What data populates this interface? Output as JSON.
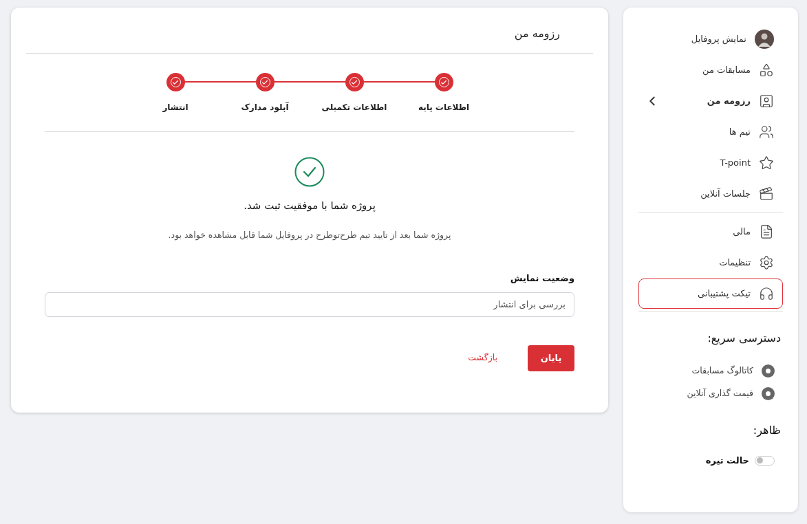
{
  "main": {
    "title": "رزومه من",
    "steps": [
      {
        "label": "اطلاعات پایه",
        "done": true
      },
      {
        "label": "اطلاعات تکمیلی",
        "done": true
      },
      {
        "label": "آپلود مدارک",
        "done": true
      },
      {
        "label": "انتشار",
        "done": true
      }
    ],
    "success_title": "پروژه شما با موفقیت ثبت شد.",
    "success_text": "پروژه شما بعد از تایید تیم طرح‌توطرح در پروفایل شما قابل مشاهده خواهد بود.",
    "field": {
      "label": "وضعیت نمایش",
      "value": "بررسی برای انتشار"
    },
    "buttons": {
      "primary": "پایان",
      "secondary": "بازگشت"
    }
  },
  "sidebar": {
    "sections": [
      [
        {
          "label": "نمایش پروفایل",
          "kind": "avatar",
          "selected": false,
          "outlined": false
        },
        {
          "label": "مسابقات من",
          "kind": "icon",
          "selected": false,
          "outlined": false
        },
        {
          "label": "رزومه من",
          "kind": "icon",
          "selected": true,
          "outlined": false
        },
        {
          "label": "تیم ها",
          "kind": "icon",
          "selected": false,
          "outlined": false
        },
        {
          "label": "T-point",
          "kind": "icon",
          "selected": false,
          "outlined": false
        },
        {
          "label": "جلسات آنلاین",
          "kind": "icon",
          "selected": false,
          "outlined": false
        }
      ],
      [
        {
          "label": "مالی",
          "kind": "icon",
          "selected": false,
          "outlined": false
        },
        {
          "label": "تنظیمات",
          "kind": "icon",
          "selected": false,
          "outlined": false
        },
        {
          "label": "تیکت پشتیبانی",
          "kind": "icon",
          "selected": false,
          "outlined": true
        }
      ]
    ],
    "quick_access": {
      "title": "دسترسی سریع:",
      "items": [
        "کاتالوگ مسابقات",
        "قیمت گذاری آنلاین"
      ]
    },
    "appearance": {
      "title": "ظاهر:",
      "toggle": {
        "label": "حالت تیره",
        "on": false
      }
    }
  }
}
